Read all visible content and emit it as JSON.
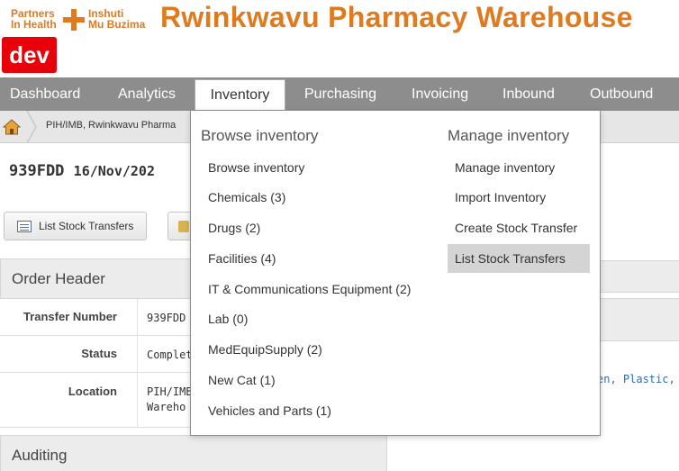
{
  "header": {
    "logo_line1": "Partners",
    "logo_line2": "In Health",
    "logo_line3": "Inshuti",
    "logo_line4": "Mu Buzima",
    "app_title": "Rwinkwavu Pharmacy Warehouse",
    "env_badge": "dev",
    "brand_color": "#e07a1f"
  },
  "nav": {
    "tabs": [
      {
        "label": "Dashboard",
        "active": false
      },
      {
        "label": "Analytics",
        "active": false
      },
      {
        "label": "Inventory",
        "active": true
      },
      {
        "label": "Purchasing",
        "active": false
      },
      {
        "label": "Invoicing",
        "active": false
      },
      {
        "label": "Inbound",
        "active": false
      },
      {
        "label": "Outbound",
        "active": false
      }
    ]
  },
  "breadcrumb": {
    "home_icon": "home-icon",
    "location": "PIH/IMB, Rwinkwavu Pharma"
  },
  "page": {
    "title_number": "939FDD",
    "title_date": "16/Nov/202"
  },
  "buttons": {
    "list_stock_transfers": "List Stock Transfers"
  },
  "order_header": {
    "title": "Order Header",
    "rows": [
      {
        "label": "Transfer Number",
        "value": "939FDD"
      },
      {
        "label": "Status",
        "value": "Complet"
      },
      {
        "label": "Location",
        "value_line1": "PIH/IMB",
        "value_line2": "Wareho"
      }
    ]
  },
  "auditing": {
    "title": "Auditing"
  },
  "right_fragment": {
    "link_text": "en, Plastic, Nor"
  },
  "dropdown": {
    "browse_heading": "Browse inventory",
    "browse_items": [
      "Browse inventory",
      "Chemicals (3)",
      "Drugs (2)",
      "Facilities (4)",
      "IT & Communications Equipment (2)",
      "Lab (0)",
      "MedEquipSupply (2)",
      "New Cat (1)",
      "Vehicles and Parts (1)"
    ],
    "manage_heading": "Manage inventory",
    "manage_items": [
      {
        "label": "Manage inventory",
        "highlighted": false
      },
      {
        "label": "Import Inventory",
        "highlighted": false
      },
      {
        "label": "Create Stock Transfer",
        "highlighted": false
      },
      {
        "label": "List Stock Transfers",
        "highlighted": true
      }
    ]
  }
}
